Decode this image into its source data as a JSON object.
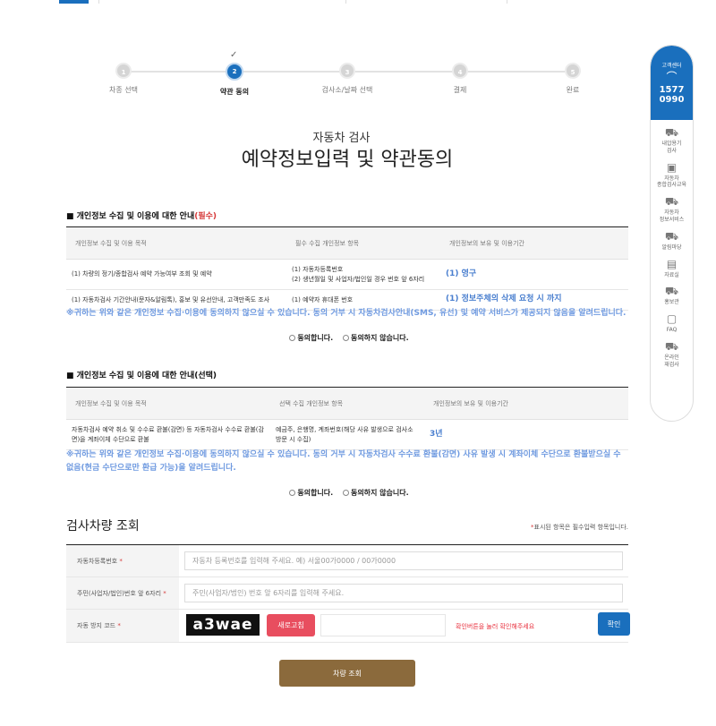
{
  "steps": [
    {
      "num": "1",
      "label": "차종 선택"
    },
    {
      "num": "2",
      "label": "약관 동의"
    },
    {
      "num": "3",
      "label": "검사소/날짜 선택"
    },
    {
      "num": "4",
      "label": "결제"
    },
    {
      "num": "5",
      "label": "완료"
    }
  ],
  "header": {
    "subtitle": "자동차 검사",
    "title": "예약정보입력 및 약관동의"
  },
  "required_section": {
    "title": "■ 개인정보 수집 및 이용에 대한 안내",
    "req_tag": "(필수)",
    "headers": [
      "개인정보 수집 및 이용 목적",
      "필수 수집 개인정보 항목",
      "개인정보의 보유 및 이용기간"
    ],
    "rows": [
      {
        "purpose": "(1) 차량의 정기/종합검사 예약 가능여부 조회 및 예약",
        "items1": "(1) 자동차등록번호",
        "items2": "(2) 생년월일 및 사업자/법인일 경우 번호 앞 6자리",
        "period": "(1) 영구"
      },
      {
        "purpose": "(1) 자동차검사 기간안내(문자&알림톡), 홍보 및 유선안내, 고객만족도 조사",
        "items1": "(1) 예약자 휴대폰 번호",
        "period": "(1) 정보주체의 삭제 요청 시 까지"
      }
    ],
    "notice": "※귀하는 위와 같은 개인정보 수집·이용에 동의하지 않으실 수 있습니다. 동의 거부 시 자동차검사안내(SMS, 유선) 및 예약 서비스가 제공되지 않음을 알려드립니다.",
    "agree": "동의합니다.",
    "disagree": "동의하지 않습니다."
  },
  "optional_section": {
    "title": "■ 개인정보 수집 및 이용에 대한 안내(선택)",
    "headers": [
      "개인정보 수집 및 이용 목적",
      "선택 수집 개인정보 항목",
      "개인정보의 보유 및 이용기간"
    ],
    "row": {
      "purpose": "자동차검사 예약 취소 및 수수료 환불(감면) 등 자동차검사 수수료 환불(감면)을 계좌이체 수단으로 환불",
      "items": "예금주, 은행명, 계좌번호(해당 사유 발생으로 검사소 방문 시 수집)",
      "period": "3년"
    },
    "notice": "※귀하는 위와 같은 개인정보 수집·이용에 동의하지 않으실 수 있습니다. 동의 거부 시 자동차검사 수수료 환불(감면) 사유 발생 시 계좌이체 수단으로 환불받으실 수 없음(현금 수단으로만 환급 가능)을 알려드립니다.",
    "agree": "동의합니다.",
    "disagree": "동의하지 않습니다."
  },
  "lookup": {
    "title": "검사차량 조회",
    "note_star": "*",
    "note": "표시된 항목은 필수입력 항목입니다.",
    "fields": [
      {
        "label": "자동차등록번호",
        "placeholder": "자동차 등록번호를 입력해 주세요. 예) 서울00가0000 / 00가0000"
      },
      {
        "label": "주민(사업자/법인)번호 앞 6자리",
        "placeholder": "주민(사업자/법인) 번호 앞 6자리를 입력해 주세요."
      }
    ],
    "captcha_label": "자동 방지 코드",
    "captcha_text": "a3wae",
    "refresh_label": "새로고침",
    "captcha_msg": "확인버튼을 눌러 확인해주세요",
    "confirm_label": "확인",
    "submit_label": "차량 조회"
  },
  "sidebar": {
    "head_label": "고객센터",
    "phone1": "1577",
    "phone2": "0990",
    "items": [
      {
        "label": "내압용기\n검사",
        "icon": "truck-icon"
      },
      {
        "label": "자동차\n종합검사교육",
        "icon": "education-icon"
      },
      {
        "label": "자동차\n정보서비스",
        "icon": "info-service-icon"
      },
      {
        "label": "알림마당",
        "icon": "notice-icon"
      },
      {
        "label": "자료실",
        "icon": "archive-icon"
      },
      {
        "label": "홍보관",
        "icon": "promotion-icon"
      },
      {
        "label": "FAQ",
        "icon": "faq-icon"
      },
      {
        "label": "온라인\n재검사",
        "icon": "online-recheck-icon"
      }
    ]
  }
}
